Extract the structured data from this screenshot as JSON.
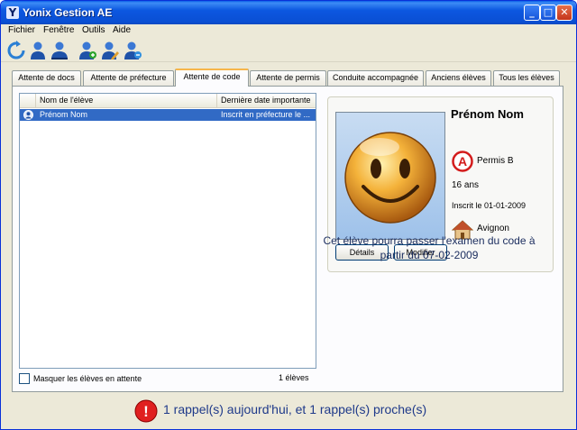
{
  "window": {
    "title": "Yonix Gestion AE",
    "title_icon": "Y"
  },
  "titlebar_buttons": {
    "minimize": "_",
    "maximize": "□",
    "close": "✕"
  },
  "menu": [
    {
      "label": "Fichier"
    },
    {
      "label": "Fenêtre"
    },
    {
      "label": "Outils"
    },
    {
      "label": "Aide"
    }
  ],
  "toolbar": [
    {
      "icon": "refresh-icon"
    },
    {
      "icon": "user-blue-icon"
    },
    {
      "icon": "user-group-icon"
    },
    {
      "icon": "user-add-icon"
    },
    {
      "icon": "user-edit-icon"
    },
    {
      "icon": "user-remove-icon"
    }
  ],
  "tabs": [
    {
      "label": "Attente de docs"
    },
    {
      "label": "Attente de préfecture"
    },
    {
      "label": "Attente de code",
      "active": true
    },
    {
      "label": "Attente de permis"
    },
    {
      "label": "Conduite accompagnée"
    },
    {
      "label": "Anciens élèves"
    },
    {
      "label": "Tous les élèves"
    }
  ],
  "list": {
    "columns": [
      "Nom de l'élève",
      "Dernière date importante"
    ],
    "rows": [
      {
        "name": "Prénom Nom",
        "last_date": "Inscrit en préfecture le ..."
      }
    ]
  },
  "footer": {
    "hide_waiting_label": "Masquer les élèves en attente",
    "count": "1 élèves"
  },
  "student": {
    "name": "Prénom Nom",
    "permit_badge": "A",
    "permit": "Permis B",
    "age": "16 ans",
    "registered": "Inscrit le 01-01-2009",
    "city": "Avignon",
    "details_button": "Détails",
    "edit_button": "Modifier"
  },
  "exam_message": "Cet élève pourra passer l'examen du code à partir du 07-02-2009",
  "status": {
    "icon": "!",
    "text": "1 rappel(s) aujourd'hui, et 1 rappel(s) proche(s)"
  },
  "colors": {
    "selection": "#316ac5",
    "titlebar": "#0a4fd3",
    "status_text": "#1f3a8a",
    "alert_red": "#e02020"
  }
}
